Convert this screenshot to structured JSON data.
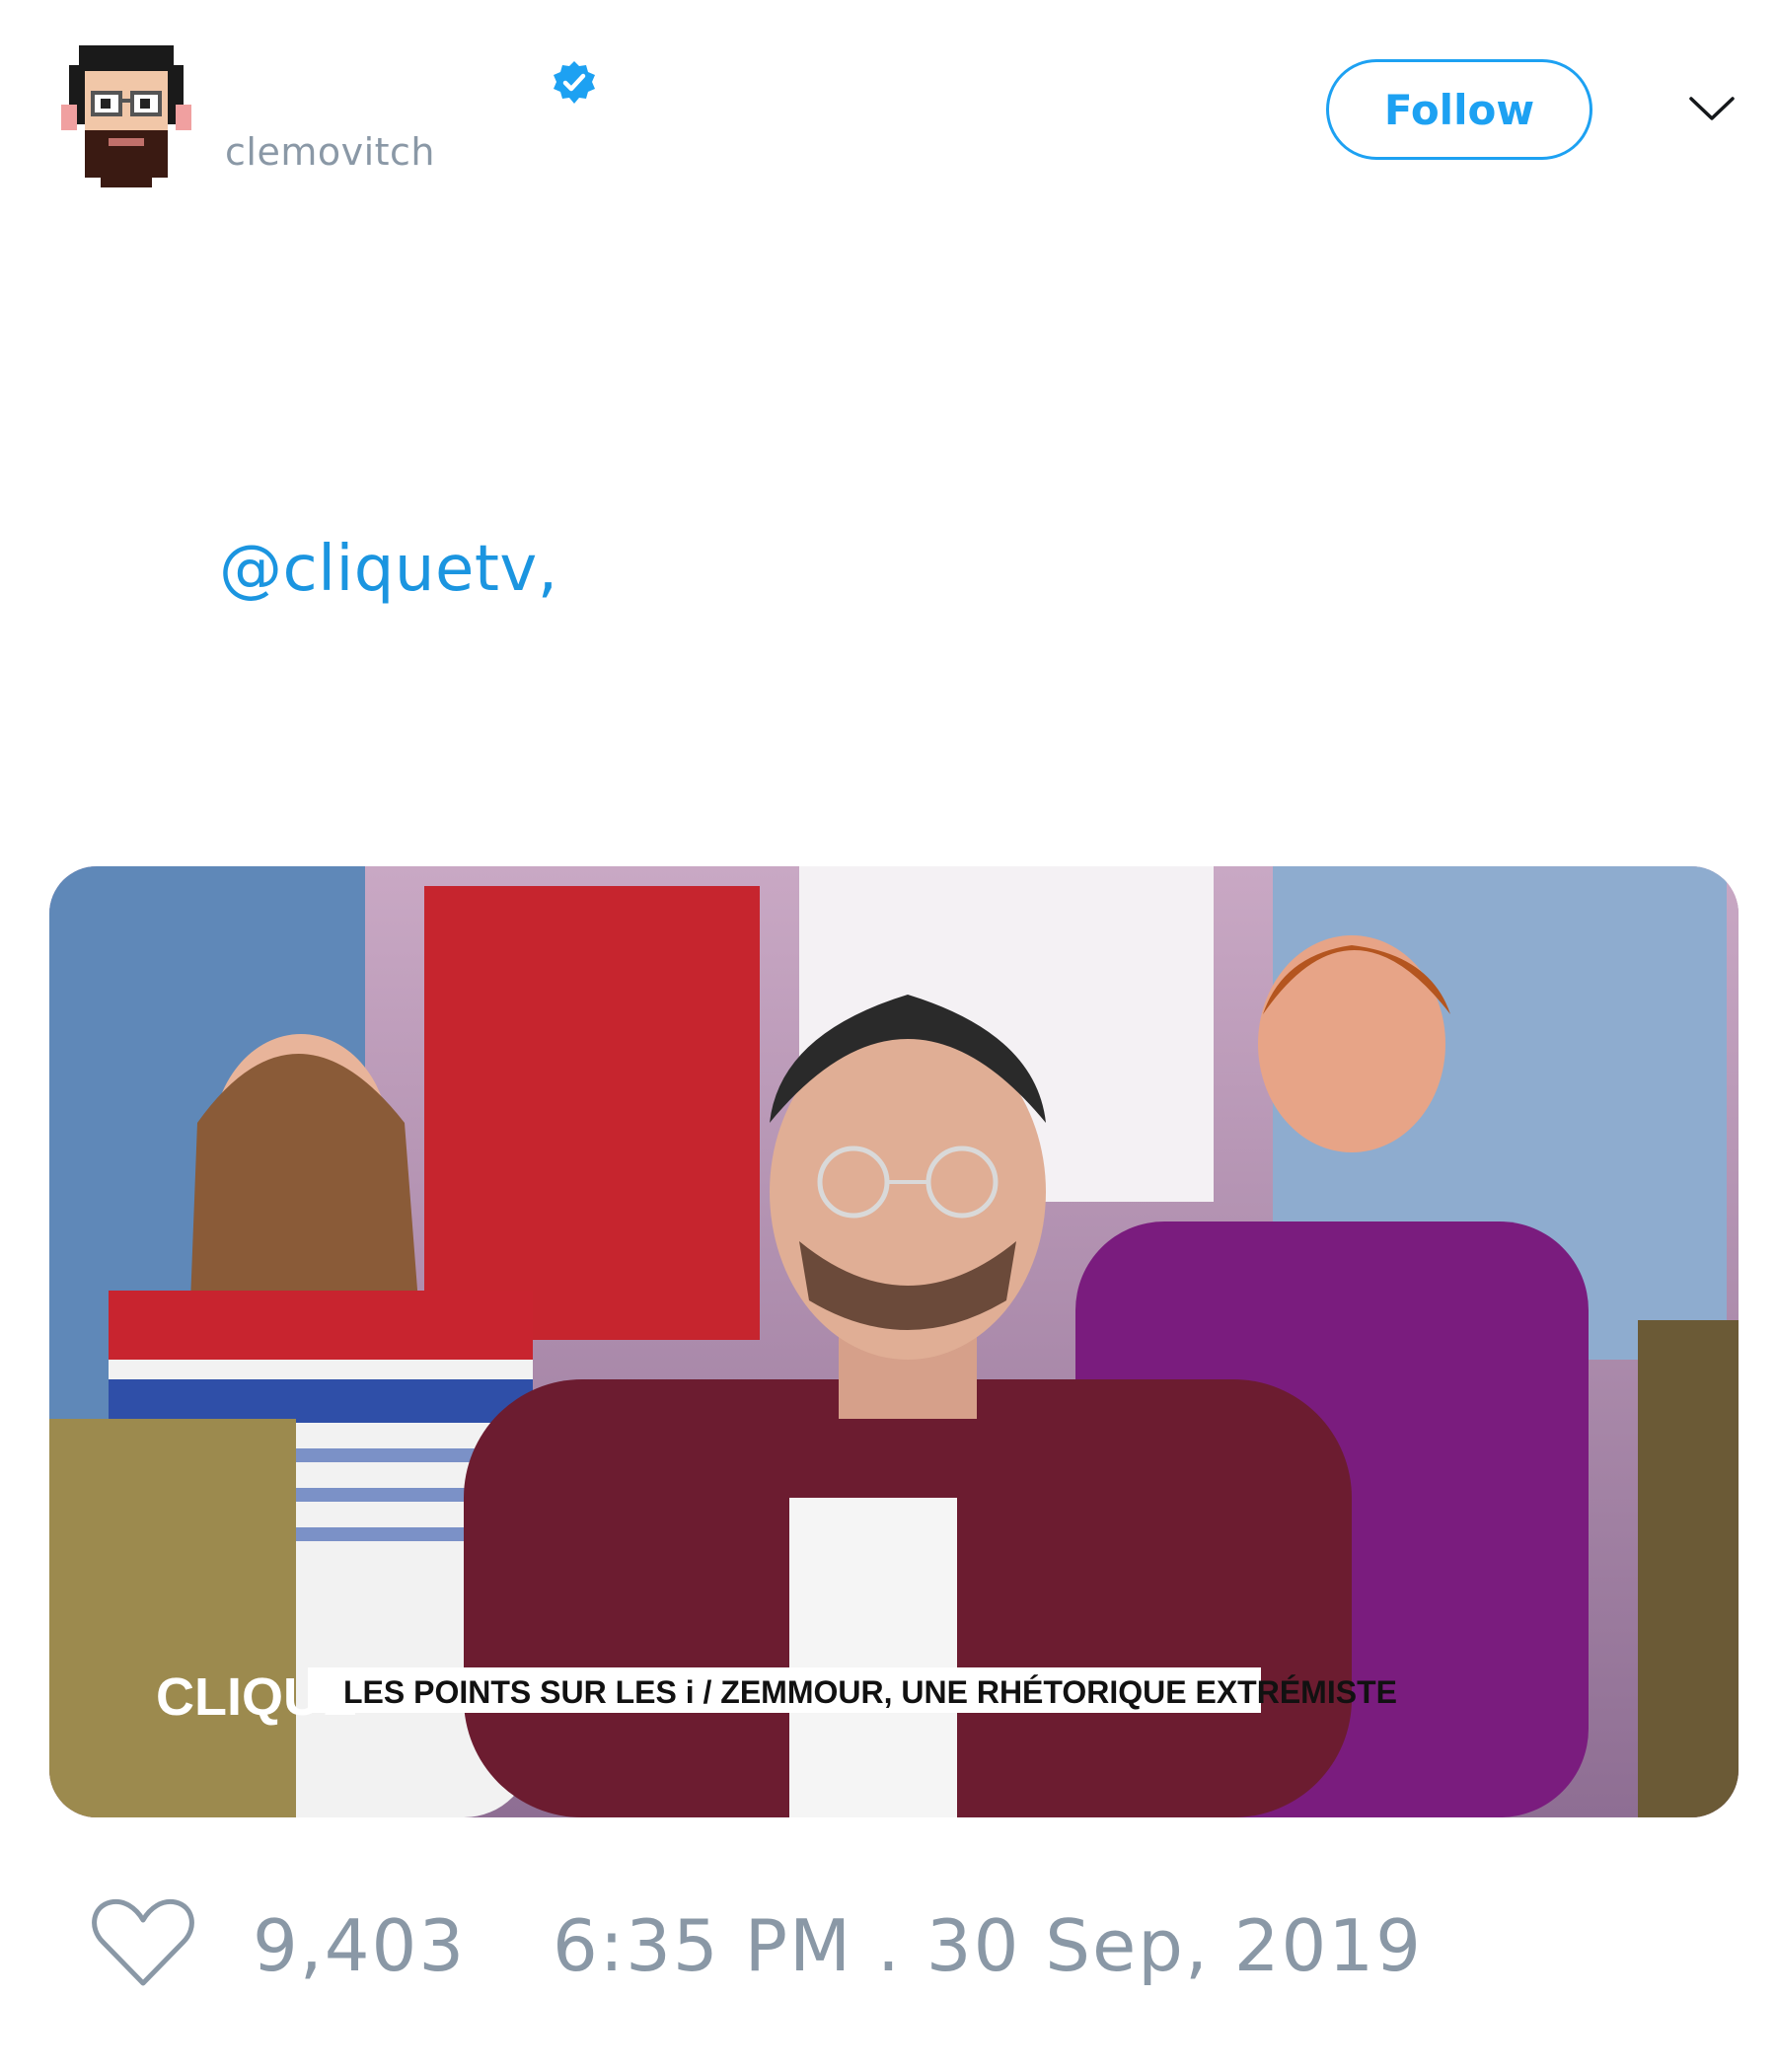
{
  "user": {
    "display_name": "",
    "handle": "clemovitch",
    "verified_icon": "verified-badge-icon",
    "verified_color": "#1da1f2"
  },
  "actions": {
    "follow_label": "Follow",
    "more_icon": "chevron-down-icon"
  },
  "tweet": {
    "text": "@cliquetv,",
    "link_color": "#1b95e0"
  },
  "media": {
    "channel_logo": "CLIQUE",
    "lower_third": "LES POINTS SUR LES i / ZEMMOUR, UNE RHÉTORIQUE EXTRÉMISTE"
  },
  "footer": {
    "like_icon": "heart-icon",
    "like_count": "9,403",
    "timestamp": "6:35 PM . 30 Sep, 2019",
    "muted_color": "#8a98a6"
  }
}
